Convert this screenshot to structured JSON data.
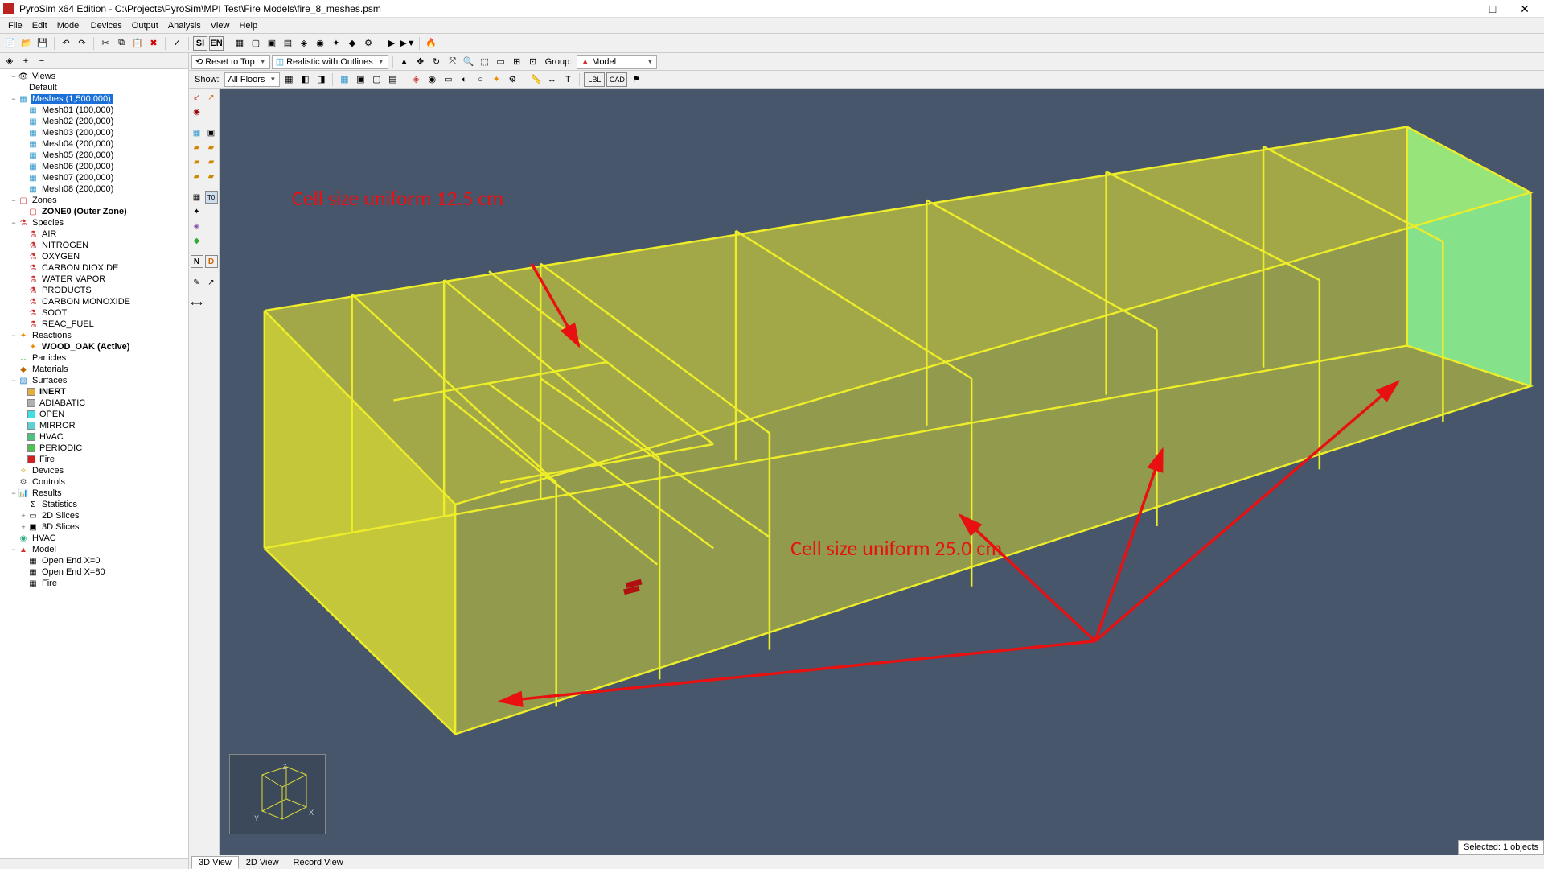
{
  "window": {
    "title": "PyroSim x64 Edition - C:\\Projects\\PyroSim\\MPI Test\\Fire Models\\fire_8_meshes.psm",
    "min": "—",
    "max": "□",
    "close": "✕"
  },
  "menus": [
    "File",
    "Edit",
    "Model",
    "Devices",
    "Output",
    "Analysis",
    "View",
    "Help"
  ],
  "toolbar1_labels": {
    "si": "SI",
    "en": "EN"
  },
  "tree_tool": {
    "expand": "+",
    "collapse": "−"
  },
  "tree": {
    "views": "Views",
    "default": "Default",
    "meshes": "Meshes (1,500,000)",
    "mesh_items": [
      "Mesh01 (100,000)",
      "Mesh02 (200,000)",
      "Mesh03 (200,000)",
      "Mesh04 (200,000)",
      "Mesh05 (200,000)",
      "Mesh06 (200,000)",
      "Mesh07 (200,000)",
      "Mesh08 (200,000)"
    ],
    "zones": "Zones",
    "zone0": "ZONE0 (Outer Zone)",
    "species": "Species",
    "species_items": [
      "AIR",
      "NITROGEN",
      "OXYGEN",
      "CARBON DIOXIDE",
      "WATER VAPOR",
      "PRODUCTS",
      "CARBON MONOXIDE",
      "SOOT",
      "REAC_FUEL"
    ],
    "reactions": "Reactions",
    "wood": "WOOD_OAK (Active)",
    "particles": "Particles",
    "materials": "Materials",
    "surfaces": "Surfaces",
    "surface_items": [
      {
        "name": "INERT",
        "color": "#e0b040"
      },
      {
        "name": "ADIABATIC",
        "color": "#b0b0b0"
      },
      {
        "name": "OPEN",
        "color": "#40e0e0"
      },
      {
        "name": "MIRROR",
        "color": "#60d0d0"
      },
      {
        "name": "HVAC",
        "color": "#50c080"
      },
      {
        "name": "PERIODIC",
        "color": "#50c050"
      },
      {
        "name": "Fire",
        "color": "#d02020"
      }
    ],
    "devices": "Devices",
    "controls": "Controls",
    "results": "Results",
    "statistics": "Statistics",
    "slices2d": "2D Slices",
    "slices3d": "3D Slices",
    "hvac": "HVAC",
    "model": "Model",
    "model_items": [
      "Open End X=0",
      "Open End X=80",
      "Fire"
    ]
  },
  "viewport": {
    "reset": "Reset to Top",
    "style": "Realistic with Outlines",
    "group_lbl": "Group:",
    "group_val": "Model",
    "show_lbl": "Show:",
    "floors": "All Floors",
    "lbl": "LBL",
    "cad": "CAD",
    "N": "N",
    "D": "D",
    "T0": "T0"
  },
  "annotations": {
    "a1": "Cell size uniform 12.5 cm",
    "a2": "Cell size uniform 25.0 cm"
  },
  "tabs": {
    "t1": "3D View",
    "t2": "2D View",
    "t3": "Record View"
  },
  "status": {
    "selected": "Selected: 1 objects"
  },
  "axes": {
    "x": "X",
    "y": "Y",
    "z": "Z"
  }
}
